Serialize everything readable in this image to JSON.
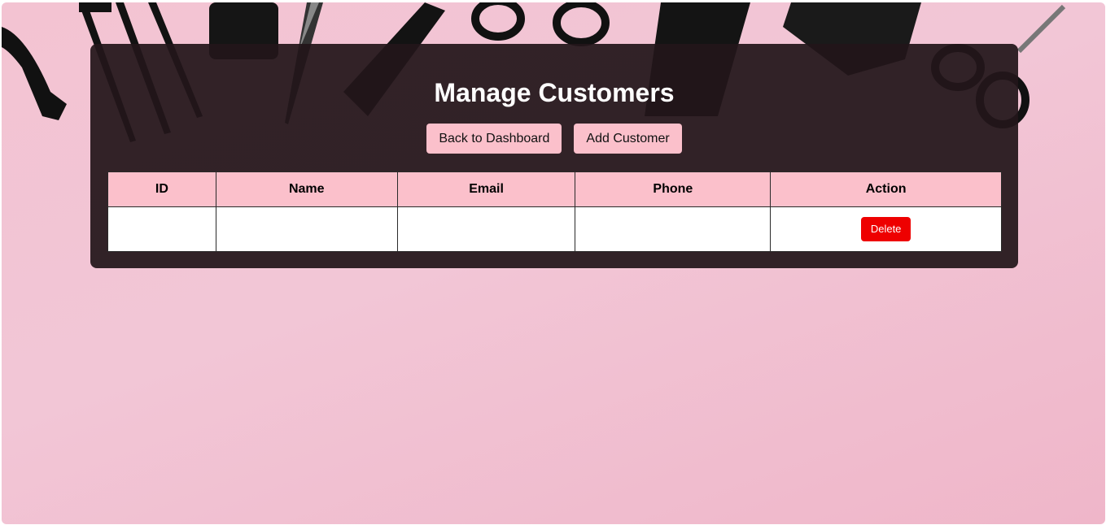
{
  "page": {
    "title": "Manage Customers"
  },
  "toolbar": {
    "back_label": "Back to Dashboard",
    "add_label": "Add Customer"
  },
  "table": {
    "columns": [
      "ID",
      "Name",
      "Email",
      "Phone",
      "Action"
    ],
    "rows": [
      {
        "id": "",
        "name": "",
        "email": "",
        "phone": "",
        "action_label": "Delete"
      }
    ]
  },
  "colors": {
    "background_pink": "#f2c4d4",
    "panel_dark": "#22161a",
    "button_pink": "#fbc0cb",
    "delete_red": "#ee0000"
  },
  "icons": {
    "background_tools": [
      "comb-icon",
      "scissors-icon",
      "hair-clip-icon",
      "fork-comb-icon"
    ]
  }
}
